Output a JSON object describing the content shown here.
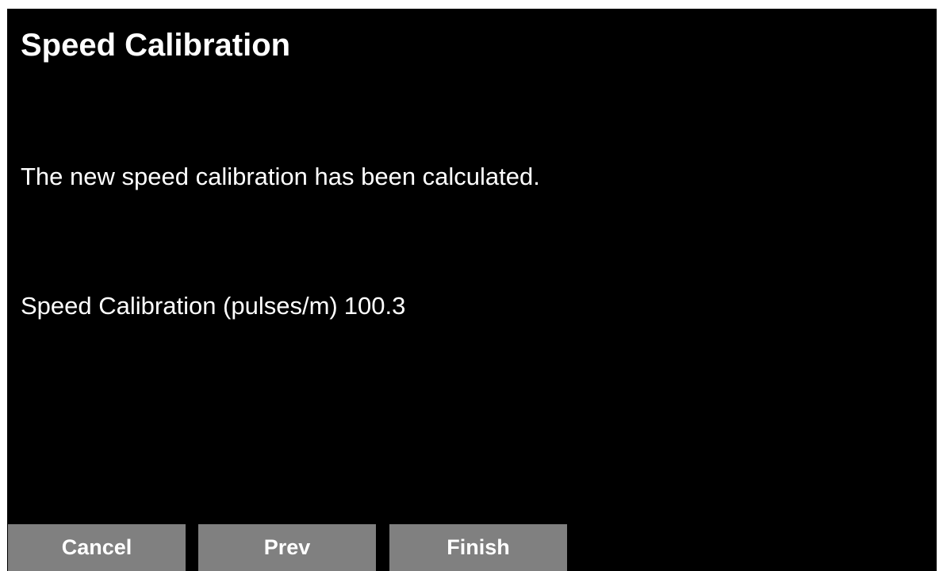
{
  "screen": {
    "title": "Speed Calibration",
    "message": "The new speed calibration has been calculated.",
    "calibration": {
      "label": "Speed Calibration (pulses/m)",
      "value": "100.3"
    }
  },
  "buttons": {
    "cancel_label": "Cancel",
    "prev_label": "Prev",
    "finish_label": "Finish"
  },
  "colors": {
    "background": "#000000",
    "text": "#ffffff",
    "button": "#808080"
  }
}
